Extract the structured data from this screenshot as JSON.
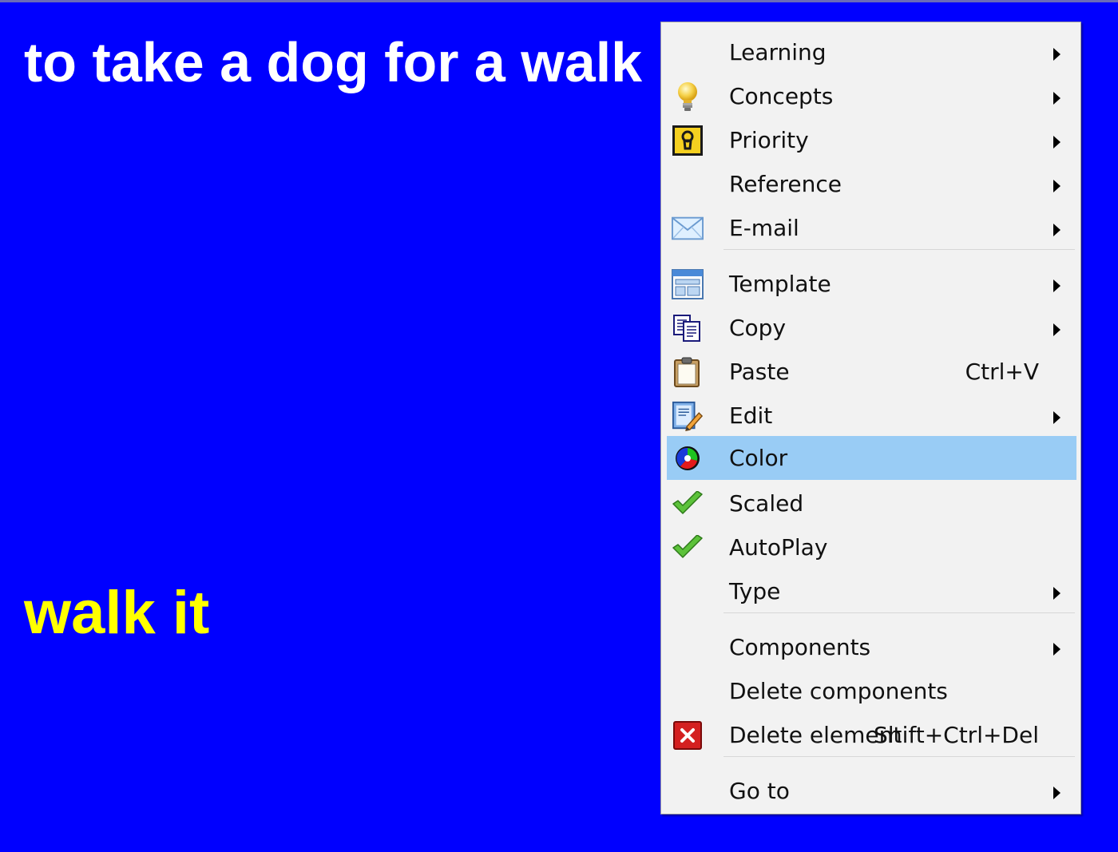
{
  "slide": {
    "question": "to take a dog for a walk",
    "answer": "walk it",
    "background_color": "#0000ff",
    "question_color": "#ffffff",
    "answer_color": "#ffff00"
  },
  "context_menu": {
    "highlight_color": "#99ccf5",
    "items": [
      {
        "label": "Learning",
        "icon": null,
        "submenu": true
      },
      {
        "label": "Concepts",
        "icon": "lightbulb-icon",
        "submenu": true
      },
      {
        "label": "Priority",
        "icon": "priority-keyhole-icon",
        "submenu": true
      },
      {
        "label": "Reference",
        "icon": null,
        "submenu": true
      },
      {
        "label": "E-mail",
        "icon": "envelope-icon",
        "submenu": true
      },
      {
        "label": "Template",
        "icon": "template-icon",
        "submenu": true
      },
      {
        "label": "Copy",
        "icon": "copy-icon",
        "submenu": true
      },
      {
        "label": "Paste",
        "icon": "clipboard-icon",
        "shortcut": "Ctrl+V"
      },
      {
        "label": "Edit",
        "icon": "edit-icon",
        "submenu": true
      },
      {
        "label": "Color",
        "icon": "color-palette-icon",
        "highlighted": true
      },
      {
        "label": "Scaled",
        "icon": "checkmark-icon",
        "checked": true
      },
      {
        "label": "AutoPlay",
        "icon": "checkmark-icon",
        "checked": true
      },
      {
        "label": "Type",
        "icon": null,
        "submenu": true
      },
      {
        "label": "Components",
        "icon": null,
        "submenu": true
      },
      {
        "label": "Delete components",
        "icon": null
      },
      {
        "label": "Delete element",
        "icon": "delete-red-x-icon",
        "shortcut": "Shift+Ctrl+Del"
      },
      {
        "label": "Go to",
        "icon": null,
        "submenu": true
      }
    ]
  }
}
